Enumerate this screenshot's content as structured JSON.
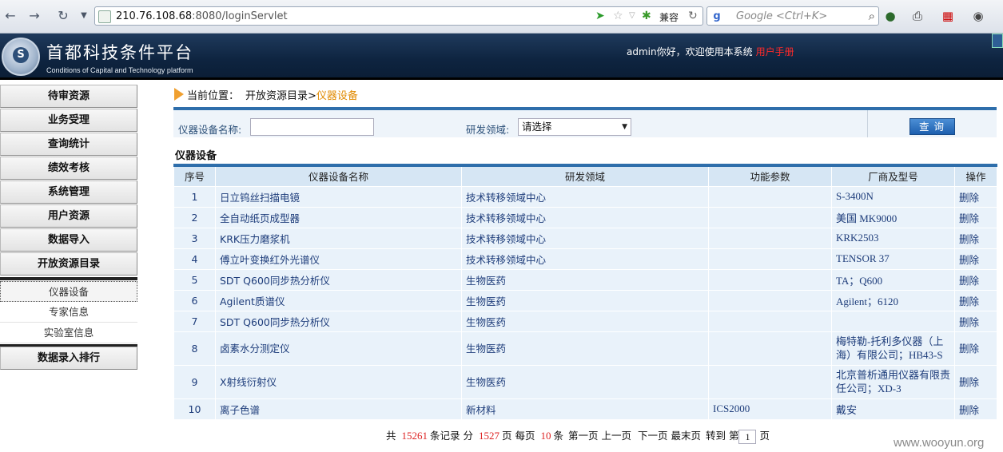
{
  "browser": {
    "url_host": "210.76.108.68",
    "url_rest": ":8080/loginServlet",
    "compat_label": "兼容",
    "search_placeholder": "Google <Ctrl+K>"
  },
  "header": {
    "title": "首都科技条件平台",
    "subtitle": "Conditions of Capital and Technology platform",
    "welcome": "admin你好，欢迎使用本系统",
    "manual_link": "用户手册"
  },
  "sidebar": {
    "items": [
      {
        "label": "待审资源"
      },
      {
        "label": "业务受理"
      },
      {
        "label": "查询统计"
      },
      {
        "label": "绩效考核"
      },
      {
        "label": "系统管理"
      },
      {
        "label": "用户资源"
      },
      {
        "label": "数据导入"
      },
      {
        "label": "开放资源目录"
      }
    ],
    "subitems": [
      {
        "label": "仪器设备"
      },
      {
        "label": "专家信息"
      },
      {
        "label": "实验室信息"
      }
    ],
    "last_item": "数据录入排行"
  },
  "breadcrumb": {
    "label": "当前位置：",
    "path": "开放资源目录>",
    "current": "仪器设备"
  },
  "search": {
    "name_label": "仪器设备名称:",
    "name_value": "",
    "field_label": "研发领域:",
    "field_value": "请选择",
    "query_button": "查询"
  },
  "section_title": "仪器设备",
  "table": {
    "headers": [
      "序号",
      "仪器设备名称",
      "研发领域",
      "功能参数",
      "厂商及型号",
      "操作"
    ],
    "rows": [
      {
        "no": "1",
        "name": "日立钨丝扫描电镜",
        "field": "技术转移领域中心",
        "params": "",
        "vendor": "S-3400N",
        "op": "删除"
      },
      {
        "no": "2",
        "name": "全自动纸页成型器",
        "field": "技术转移领域中心",
        "params": "",
        "vendor": "美国 MK9000",
        "op": "删除"
      },
      {
        "no": "3",
        "name": "KRK压力磨浆机",
        "field": "技术转移领域中心",
        "params": "",
        "vendor": "KRK2503",
        "op": "删除"
      },
      {
        "no": "4",
        "name": "傅立叶变换红外光谱仪",
        "field": "技术转移领域中心",
        "params": "",
        "vendor": "TENSOR 37",
        "op": "删除"
      },
      {
        "no": "5",
        "name": "SDT Q600同步热分析仪",
        "field": "生物医药",
        "params": "",
        "vendor": "TA；Q600",
        "op": "删除"
      },
      {
        "no": "6",
        "name": "Agilent质谱仪",
        "field": "生物医药",
        "params": "",
        "vendor": "Agilent；6120",
        "op": "删除"
      },
      {
        "no": "7",
        "name": "SDT Q600同步热分析仪",
        "field": "生物医药",
        "params": "",
        "vendor": "",
        "op": "删除"
      },
      {
        "no": "8",
        "name": "卤素水分测定仪",
        "field": "生物医药",
        "params": "",
        "vendor": "梅特勒-托利多仪器（上海）有限公司；HB43-S",
        "op": "删除"
      },
      {
        "no": "9",
        "name": "X射线衍射仪",
        "field": "生物医药",
        "params": "",
        "vendor": "北京普析通用仪器有限责任公司；XD-3",
        "op": "删除"
      },
      {
        "no": "10",
        "name": "离子色谱",
        "field": "新材料",
        "params": "ICS2000",
        "vendor": "戴安",
        "op": "删除"
      }
    ]
  },
  "pager": {
    "total_prefix": "共",
    "total_records": "15261",
    "records_suffix": "条记录 分",
    "total_pages": "1527",
    "pages_suffix": "页 每页",
    "per_page": "10",
    "per_page_suffix": "条",
    "first": "第一页",
    "prev": "上一页",
    "next": "下一页",
    "last": "最末页",
    "goto_prefix": "转到 第",
    "current_page": "1",
    "goto_suffix": "页"
  },
  "watermark": "www.wooyun.org"
}
